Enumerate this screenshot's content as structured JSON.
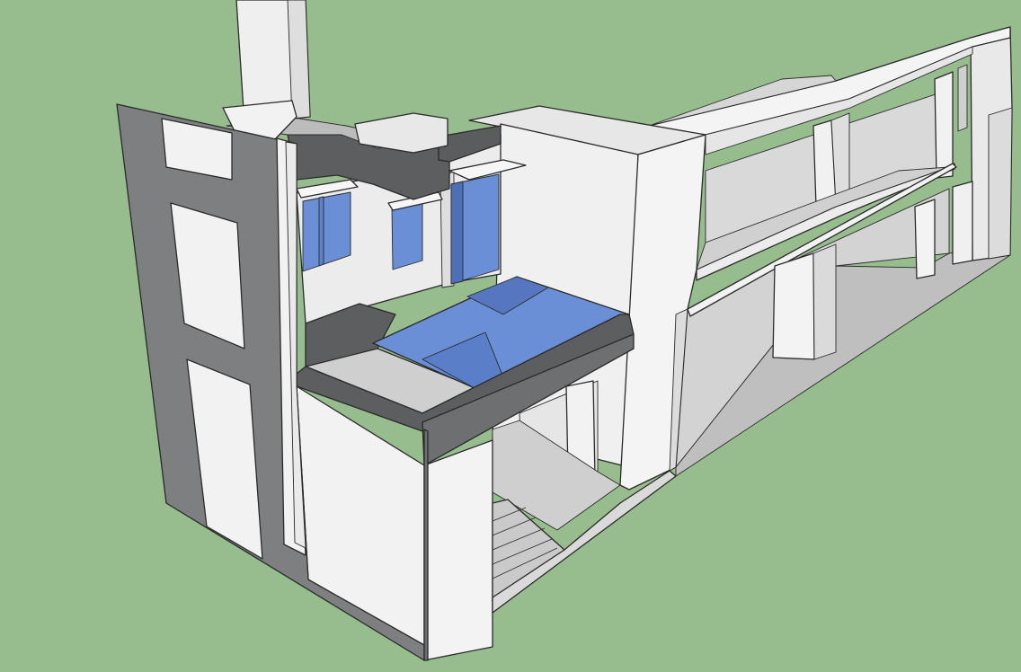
{
  "scene": {
    "colors": {
      "ground": "#97bd8e",
      "wall_light": "#efefef",
      "wall_shade": "#dedede",
      "wall_dark": "#7d7f80",
      "slab_gray": "#c8c8c8",
      "slab_dark": "#5a5c5d",
      "glass": "#6a8fd6",
      "glass_dark": "#4d6fb6",
      "edge": "#2a2a2a"
    }
  }
}
